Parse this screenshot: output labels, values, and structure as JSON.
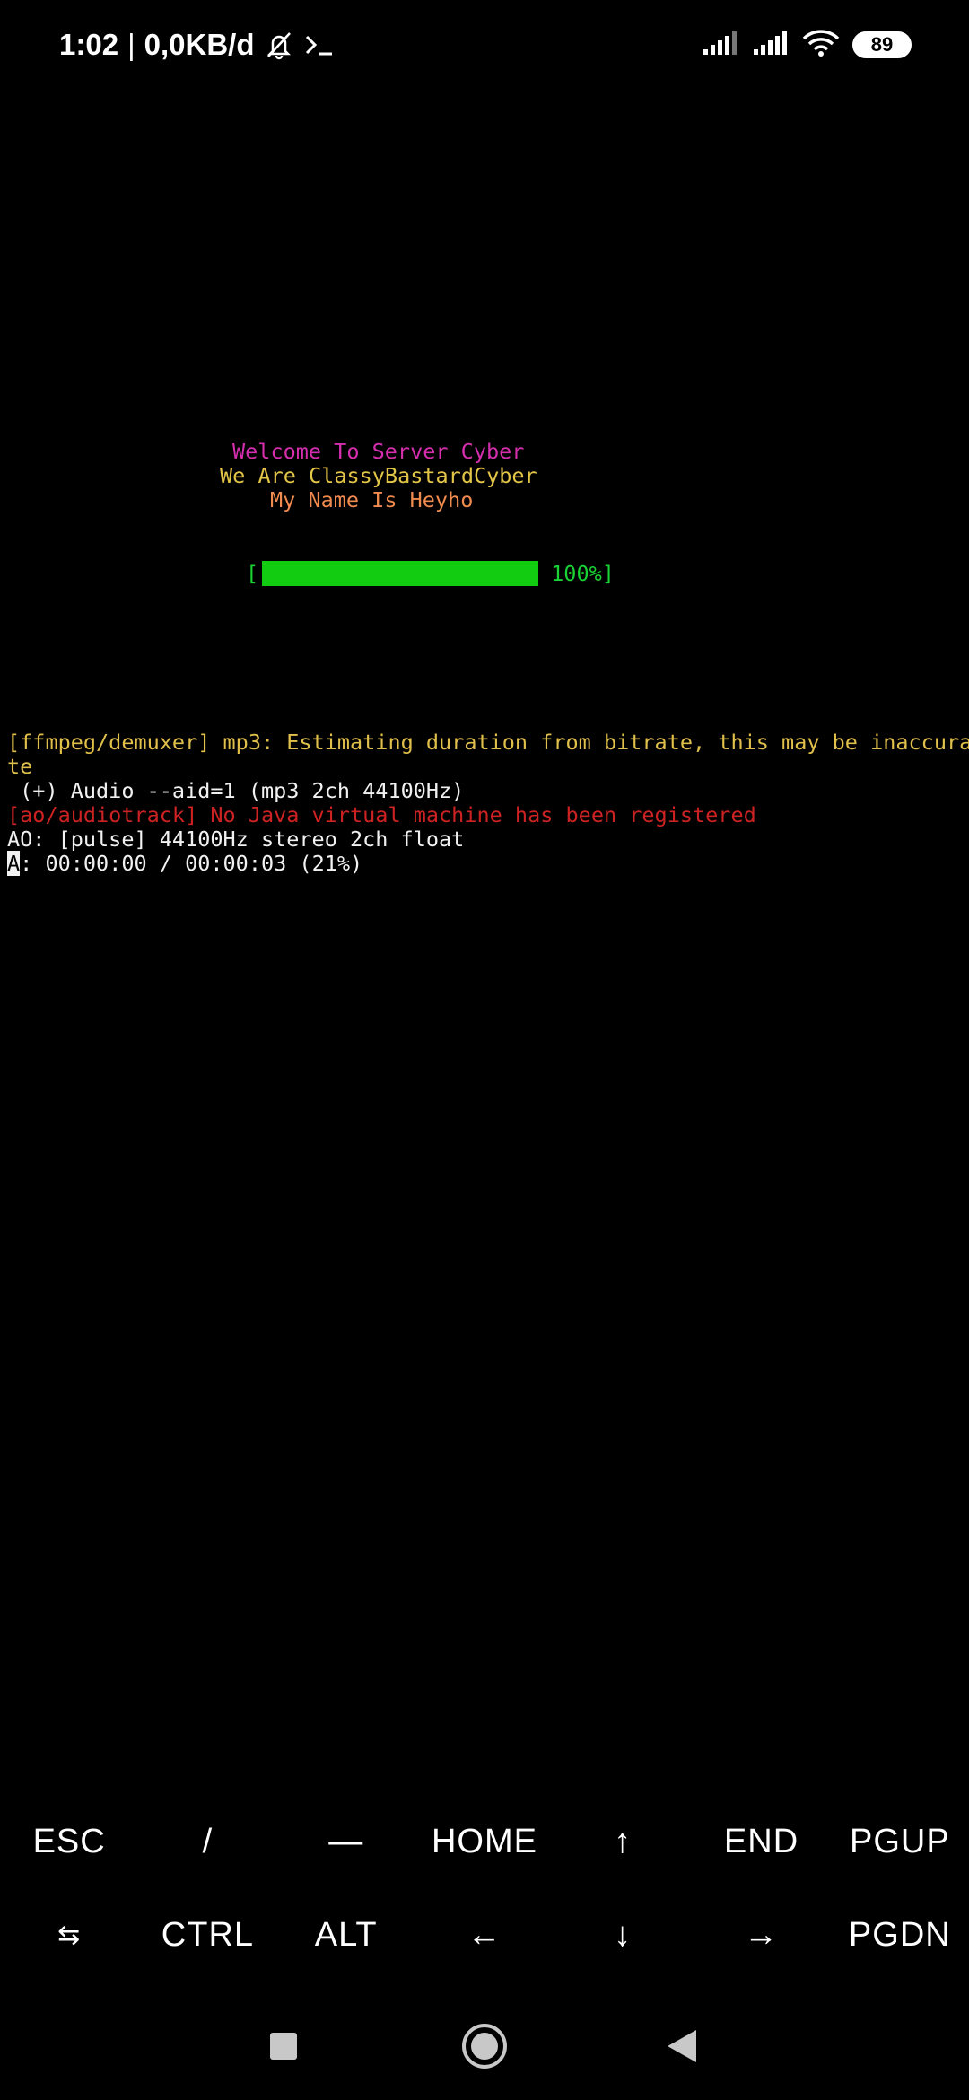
{
  "status_bar": {
    "time": "1:02",
    "separator": "|",
    "network_speed": "0,0KB/d",
    "icons": [
      "mute-bell-icon",
      "terminal-prompt-icon",
      "signal-icon",
      "signal-icon",
      "wifi-icon"
    ],
    "battery": "89"
  },
  "terminal": {
    "banner": {
      "line1": "Welcome To Server Cyber",
      "line2": "We Are ClassyBastardCyber",
      "line3": "My Name Is Heyho"
    },
    "progress": {
      "open_bracket": "[",
      "percent_label": "100%]",
      "fill": 1.0
    },
    "log": {
      "warn_line1": "[ffmpeg/demuxer] mp3: Estimating duration from bitrate, this may be inaccura",
      "warn_line2": "te",
      "audio_line": " (+) Audio --aid=1 (mp3 2ch 44100Hz)",
      "error_line": "[ao/audiotrack] No Java virtual machine has been registered",
      "ao_line": "AO: [pulse] 44100Hz stereo 2ch float",
      "status_cursor_char": "A",
      "status_rest": ": 00:00:00 / 00:00:03 (21%)"
    },
    "colors": {
      "magenta": "#d52fae",
      "yellow": "#e3c647",
      "orange": "#f08a4e",
      "green": "#19d233",
      "error": "#cc2222"
    }
  },
  "extra_keys": {
    "row1": [
      "ESC",
      "/",
      "—",
      "HOME",
      "↑",
      "END",
      "PGUP"
    ],
    "row2": [
      "⇆",
      "CTRL",
      "ALT",
      "←",
      "↓",
      "→",
      "PGDN"
    ]
  },
  "nav_bar": {
    "icons": [
      "recent-apps-icon",
      "home-icon",
      "back-icon"
    ]
  }
}
